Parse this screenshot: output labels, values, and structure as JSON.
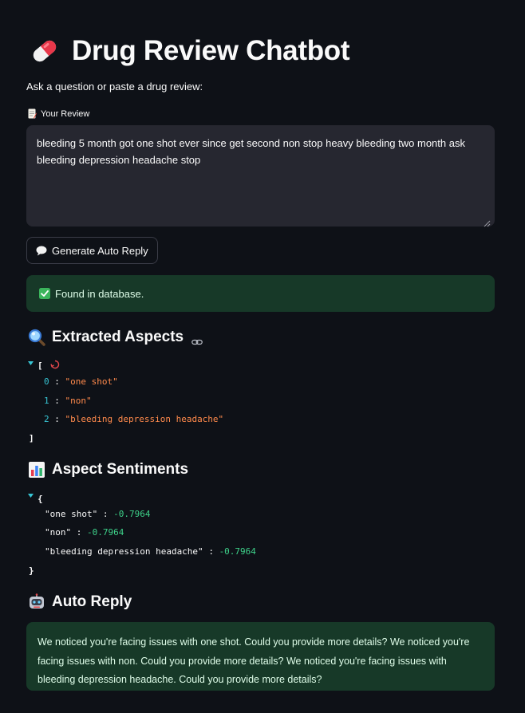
{
  "header": {
    "title": "Drug Review Chatbot",
    "title_icon": "pill-icon"
  },
  "prompt": "Ask a question or paste a drug review:",
  "review_field": {
    "label": "Your Review",
    "label_icon": "memo-icon",
    "value": "bleeding 5 month got one shot ever since get second non stop heavy bleeding two month ask bleeding depression headache stop"
  },
  "generate_button": {
    "label": "Generate Auto Reply",
    "icon": "speech-balloon-icon"
  },
  "status": {
    "text": "Found in database.",
    "icon": "check-mark-button-icon",
    "color": "#173928"
  },
  "aspects": {
    "title": "Extracted Aspects",
    "icon": "magnifying-glass-icon",
    "open_bracket": "[",
    "close_bracket": "]",
    "items": [
      {
        "index": "0",
        "value": "\"one shot\""
      },
      {
        "index": "1",
        "value": "\"non\""
      },
      {
        "index": "2",
        "value": "\"bleeding depression headache\""
      }
    ]
  },
  "sentiments": {
    "title": "Aspect Sentiments",
    "icon": "bar-chart-icon",
    "open_brace": "{",
    "close_brace": "}",
    "items": [
      {
        "key": "\"one shot\"",
        "value": "-0.7964"
      },
      {
        "key": "\"non\"",
        "value": "-0.7964"
      },
      {
        "key": "\"bleeding depression headache\"",
        "value": "-0.7964"
      }
    ]
  },
  "auto_reply": {
    "title": "Auto Reply",
    "icon": "robot-icon",
    "text": "We noticed you're facing issues with one shot. Could you provide more details? We noticed you're facing issues with non. Could you provide more details? We noticed you're facing issues with bleeding depression headache. Could you provide more details?"
  },
  "colors": {
    "background": "#0e1117",
    "input_background": "#262730",
    "success_background": "#173928",
    "string_value": "#ff8a4c",
    "number_value": "#3ed28a",
    "index": "#37c5d4"
  }
}
